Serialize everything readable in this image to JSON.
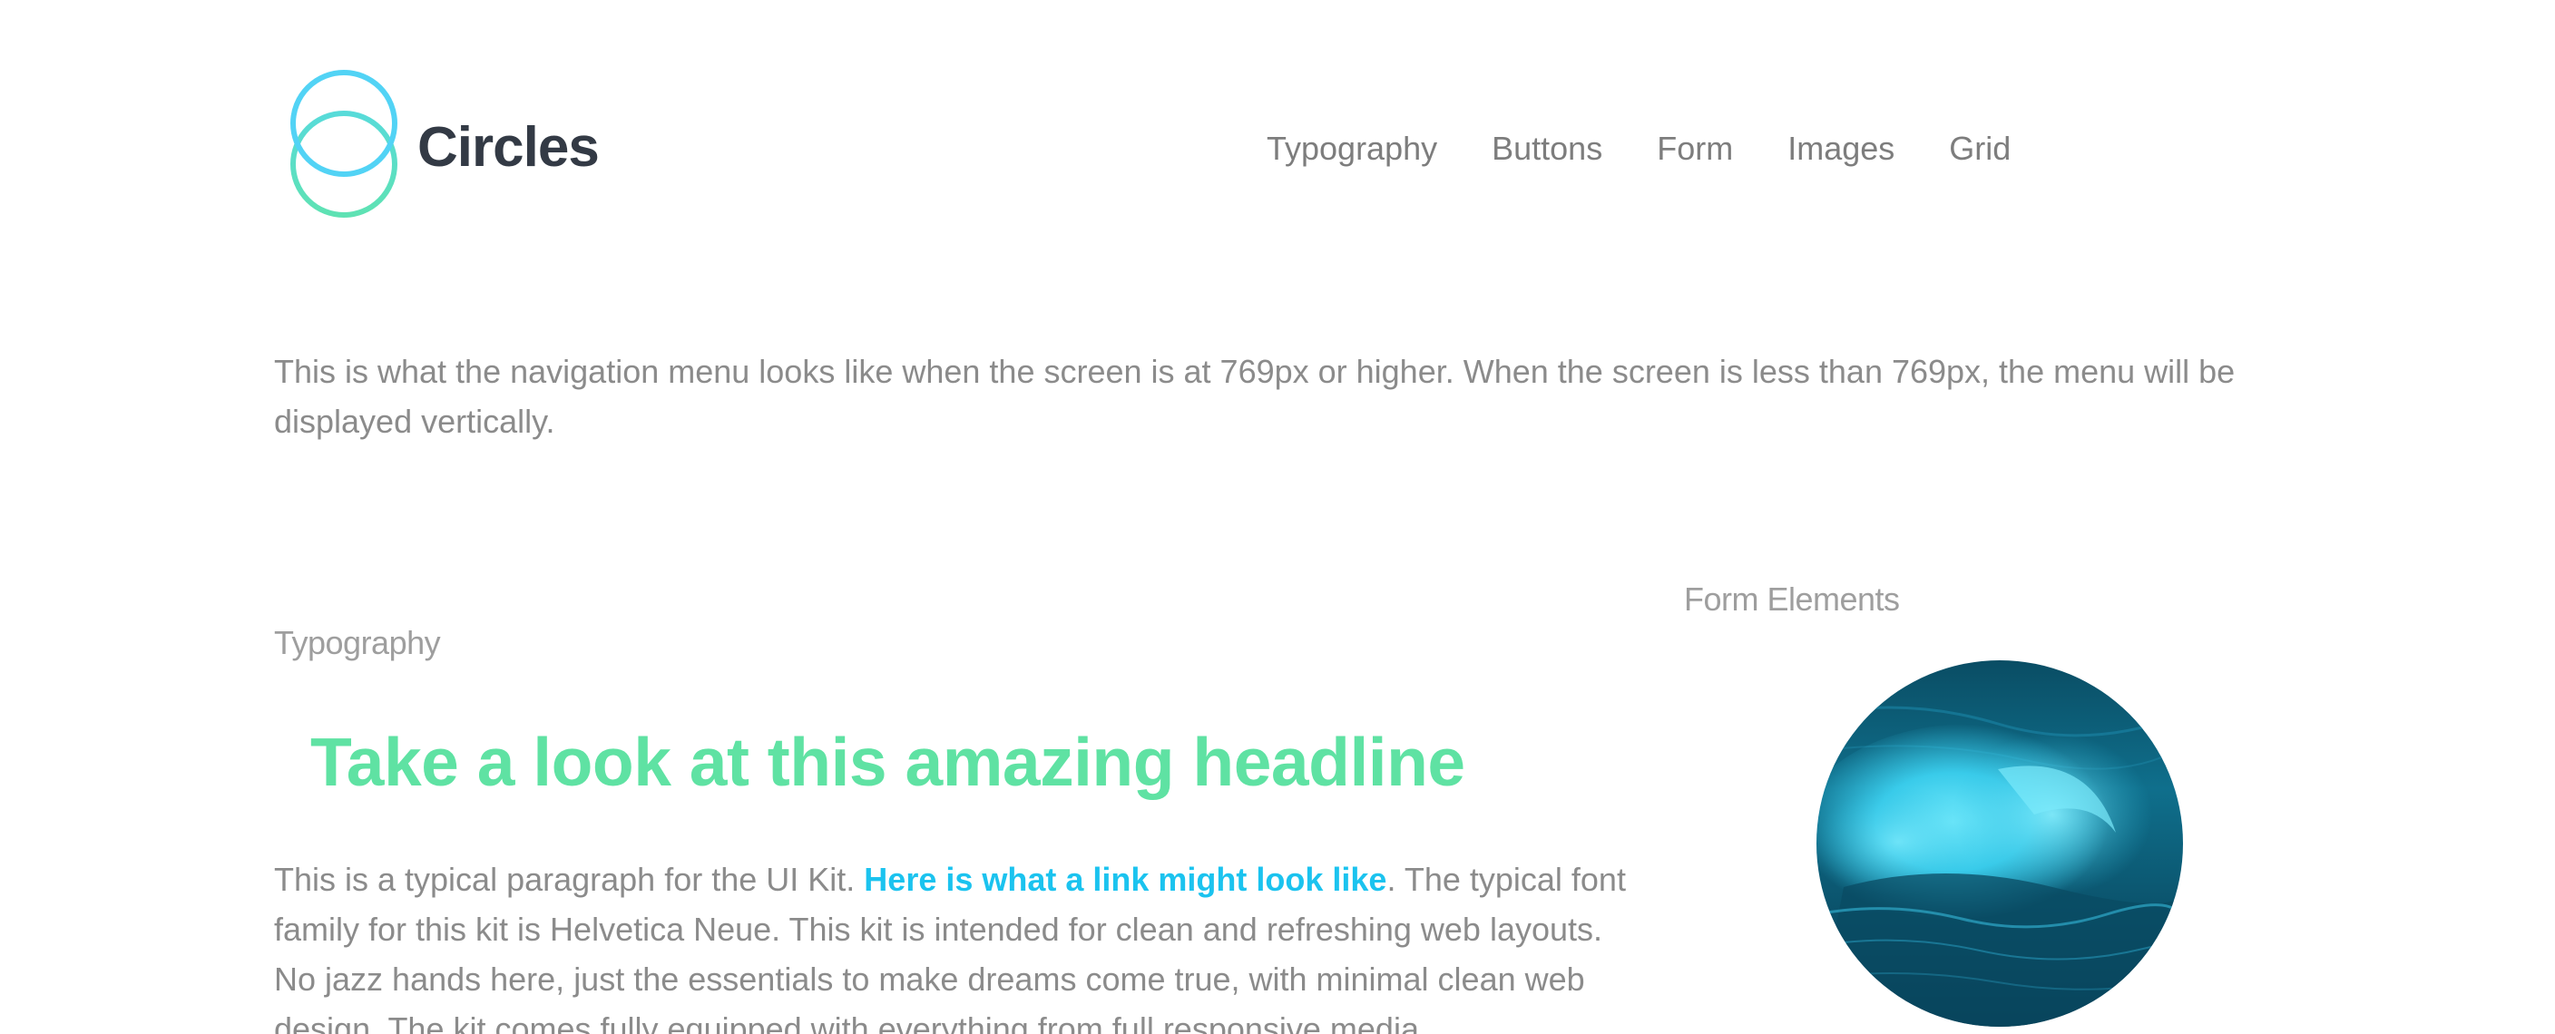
{
  "logo": {
    "text": "Circles",
    "icon": "two-interlocking-circles-icon",
    "colors": {
      "top_circle": "#52d3f5",
      "bottom_circle": "#5ee2b3",
      "text": "#333a45"
    }
  },
  "nav": {
    "items": [
      {
        "label": "Typography"
      },
      {
        "label": "Buttons"
      },
      {
        "label": "Form"
      },
      {
        "label": "Images"
      },
      {
        "label": "Grid"
      }
    ]
  },
  "intro": {
    "text": "This is what the navigation menu looks like when the screen is at 769px or higher. When the screen is less than 769px, the menu will be displayed vertically."
  },
  "typography": {
    "section_label": "Typography",
    "headline": "Take a look at this amazing headline",
    "paragraph_before_link": "This is a typical paragraph for the UI Kit. ",
    "link_text": "Here is what a link might look like",
    "paragraph_after_link": ". The typical font family for this kit is Helvetica Neue. This kit is intended for clean and refreshing web layouts. No jazz hands here, just the essentials to make dreams come true, with minimal clean web design. The kit comes fully equipped with everything from full responsive media"
  },
  "form": {
    "section_label": "Form Elements",
    "image": "ocean-wave-circle-image"
  },
  "colors": {
    "headline": "#5fe2a3",
    "link": "#1bc3ef",
    "body_text": "#8b8b8b",
    "label_text": "#9e9e9e",
    "nav_text": "#7d7d7d"
  }
}
